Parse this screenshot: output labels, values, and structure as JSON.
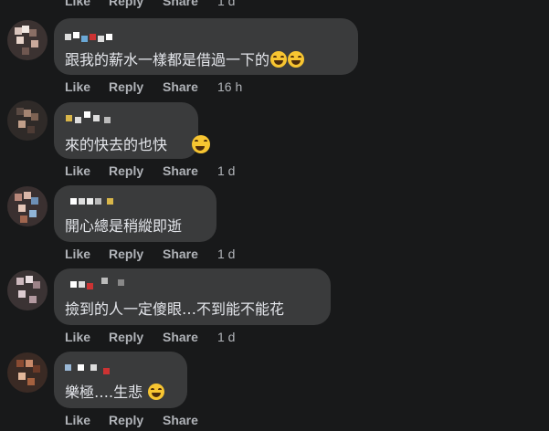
{
  "comments": [
    {
      "text": "跟我的薪水一樣都是借過一下的",
      "emoji": [
        "rolling-laughing-emoji",
        "rolling-laughing-emoji"
      ],
      "like": "Like",
      "reply": "Reply",
      "share": "Share",
      "time": "16 h"
    },
    {
      "text": "來的快去的也快",
      "emoji": [
        "grinning-squinting-emoji"
      ],
      "like": "Like",
      "reply": "Reply",
      "share": "Share",
      "time": "1 d"
    },
    {
      "text": "開心總是稍縱即逝",
      "emoji": [],
      "like": "Like",
      "reply": "Reply",
      "share": "Share",
      "time": "1 d"
    },
    {
      "text": "撿到的人一定傻眼…不到能不能花",
      "emoji": [],
      "like": "Like",
      "reply": "Reply",
      "share": "Share",
      "time": "1 d"
    },
    {
      "text": "樂極….生悲",
      "emoji": [
        "rolling-laughing-emoji"
      ],
      "like": "Like",
      "reply": "Reply",
      "share": "Share",
      "time": ""
    }
  ],
  "top_actions": {
    "like": "Like",
    "reply": "Reply",
    "share": "Share",
    "time": "1 d"
  },
  "colors": {
    "background": "#18191a",
    "bubble": "#3a3b3c",
    "text": "#e4e6eb",
    "meta": "#b0b3b8"
  }
}
